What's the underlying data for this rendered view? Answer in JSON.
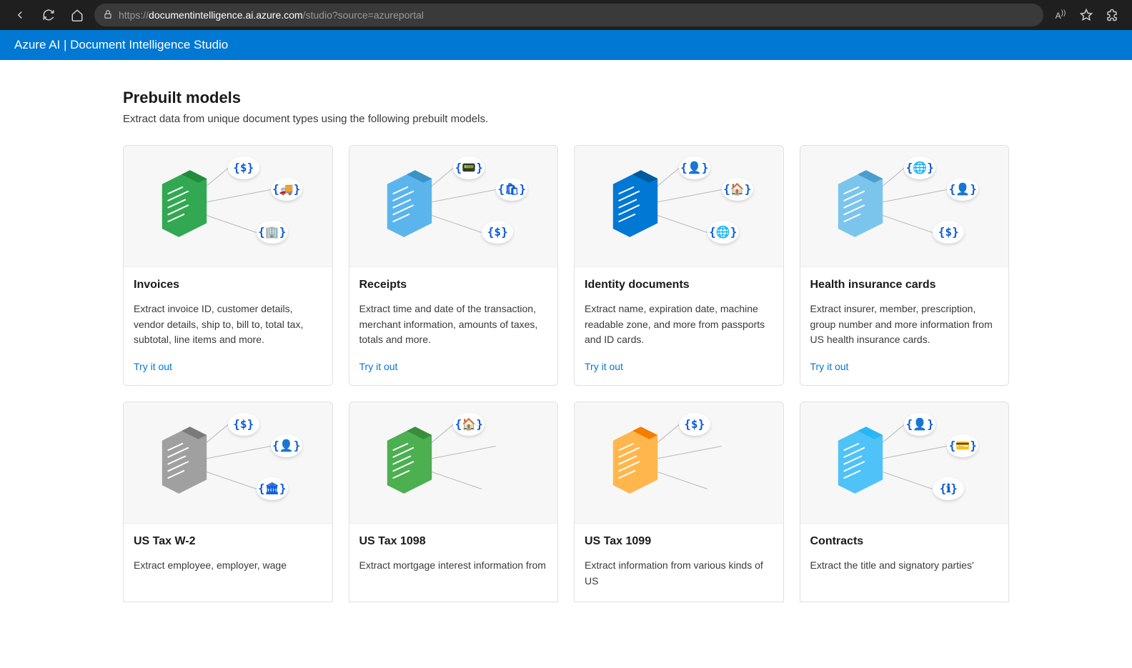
{
  "browser": {
    "url_domain": "documentintelligence.ai.azure.com",
    "url_prefix": "https://",
    "url_path": "/studio?source=azureportal"
  },
  "header": {
    "title": "Azure AI | Document Intelligence Studio"
  },
  "section": {
    "title": "Prebuilt models",
    "subtitle": "Extract data from unique document types using the following prebuilt models."
  },
  "cards": [
    {
      "title": "Invoices",
      "desc": "Extract invoice ID, customer details, vendor details, ship to, bill to, total tax, subtotal, line items and more.",
      "link": "Try it out",
      "doc_fill": "#33A852",
      "doc_fold": "#228B3C",
      "bubbles": [
        "{$}",
        "{🚚}",
        "{🏢}"
      ]
    },
    {
      "title": "Receipts",
      "desc": "Extract time and date of the transaction, merchant information, amounts of taxes, totals and more.",
      "link": "Try it out",
      "doc_fill": "#5BB5EC",
      "doc_fold": "#3A92C5",
      "bubbles": [
        "{📟}",
        "{🛍}",
        "{$}"
      ]
    },
    {
      "title": "Identity documents",
      "desc": "Extract name, expiration date, machine readable zone, and more from passports and ID cards.",
      "link": "Try it out",
      "doc_fill": "#0078D4",
      "doc_fold": "#005A9E",
      "bubbles": [
        "{👤}",
        "{🏠}",
        "{🌐}"
      ]
    },
    {
      "title": "Health insurance cards",
      "desc": "Extract insurer, member, prescription, group number and more information from US health insurance cards.",
      "link": "Try it out",
      "doc_fill": "#7BC5ED",
      "doc_fold": "#4A9ECB",
      "bubbles": [
        "{🌐}",
        "{👤}",
        "{$}"
      ]
    },
    {
      "title": "US Tax W-2",
      "desc": "Extract employee, employer, wage",
      "link": "",
      "doc_fill": "#A0A0A0",
      "doc_fold": "#7A7A7A",
      "bubbles": [
        "{$}",
        "{👤}",
        "{🏛}"
      ]
    },
    {
      "title": "US Tax 1098",
      "desc": "Extract mortgage interest information from",
      "link": "",
      "doc_fill": "#4CAF50",
      "doc_fold": "#388E3C",
      "bubbles": [
        "{🏠}",
        "",
        ""
      ]
    },
    {
      "title": "US Tax 1099",
      "desc": "Extract information from various kinds of US",
      "link": "",
      "doc_fill": "#FFB74D",
      "doc_fold": "#F57C00",
      "bubbles": [
        "{$}",
        "",
        ""
      ]
    },
    {
      "title": "Contracts",
      "desc": "Extract the title and signatory parties'",
      "link": "",
      "doc_fill": "#4FC3F7",
      "doc_fold": "#29B6F6",
      "bubbles": [
        "{👤}",
        "{💳}",
        "{ℹ}"
      ]
    }
  ]
}
